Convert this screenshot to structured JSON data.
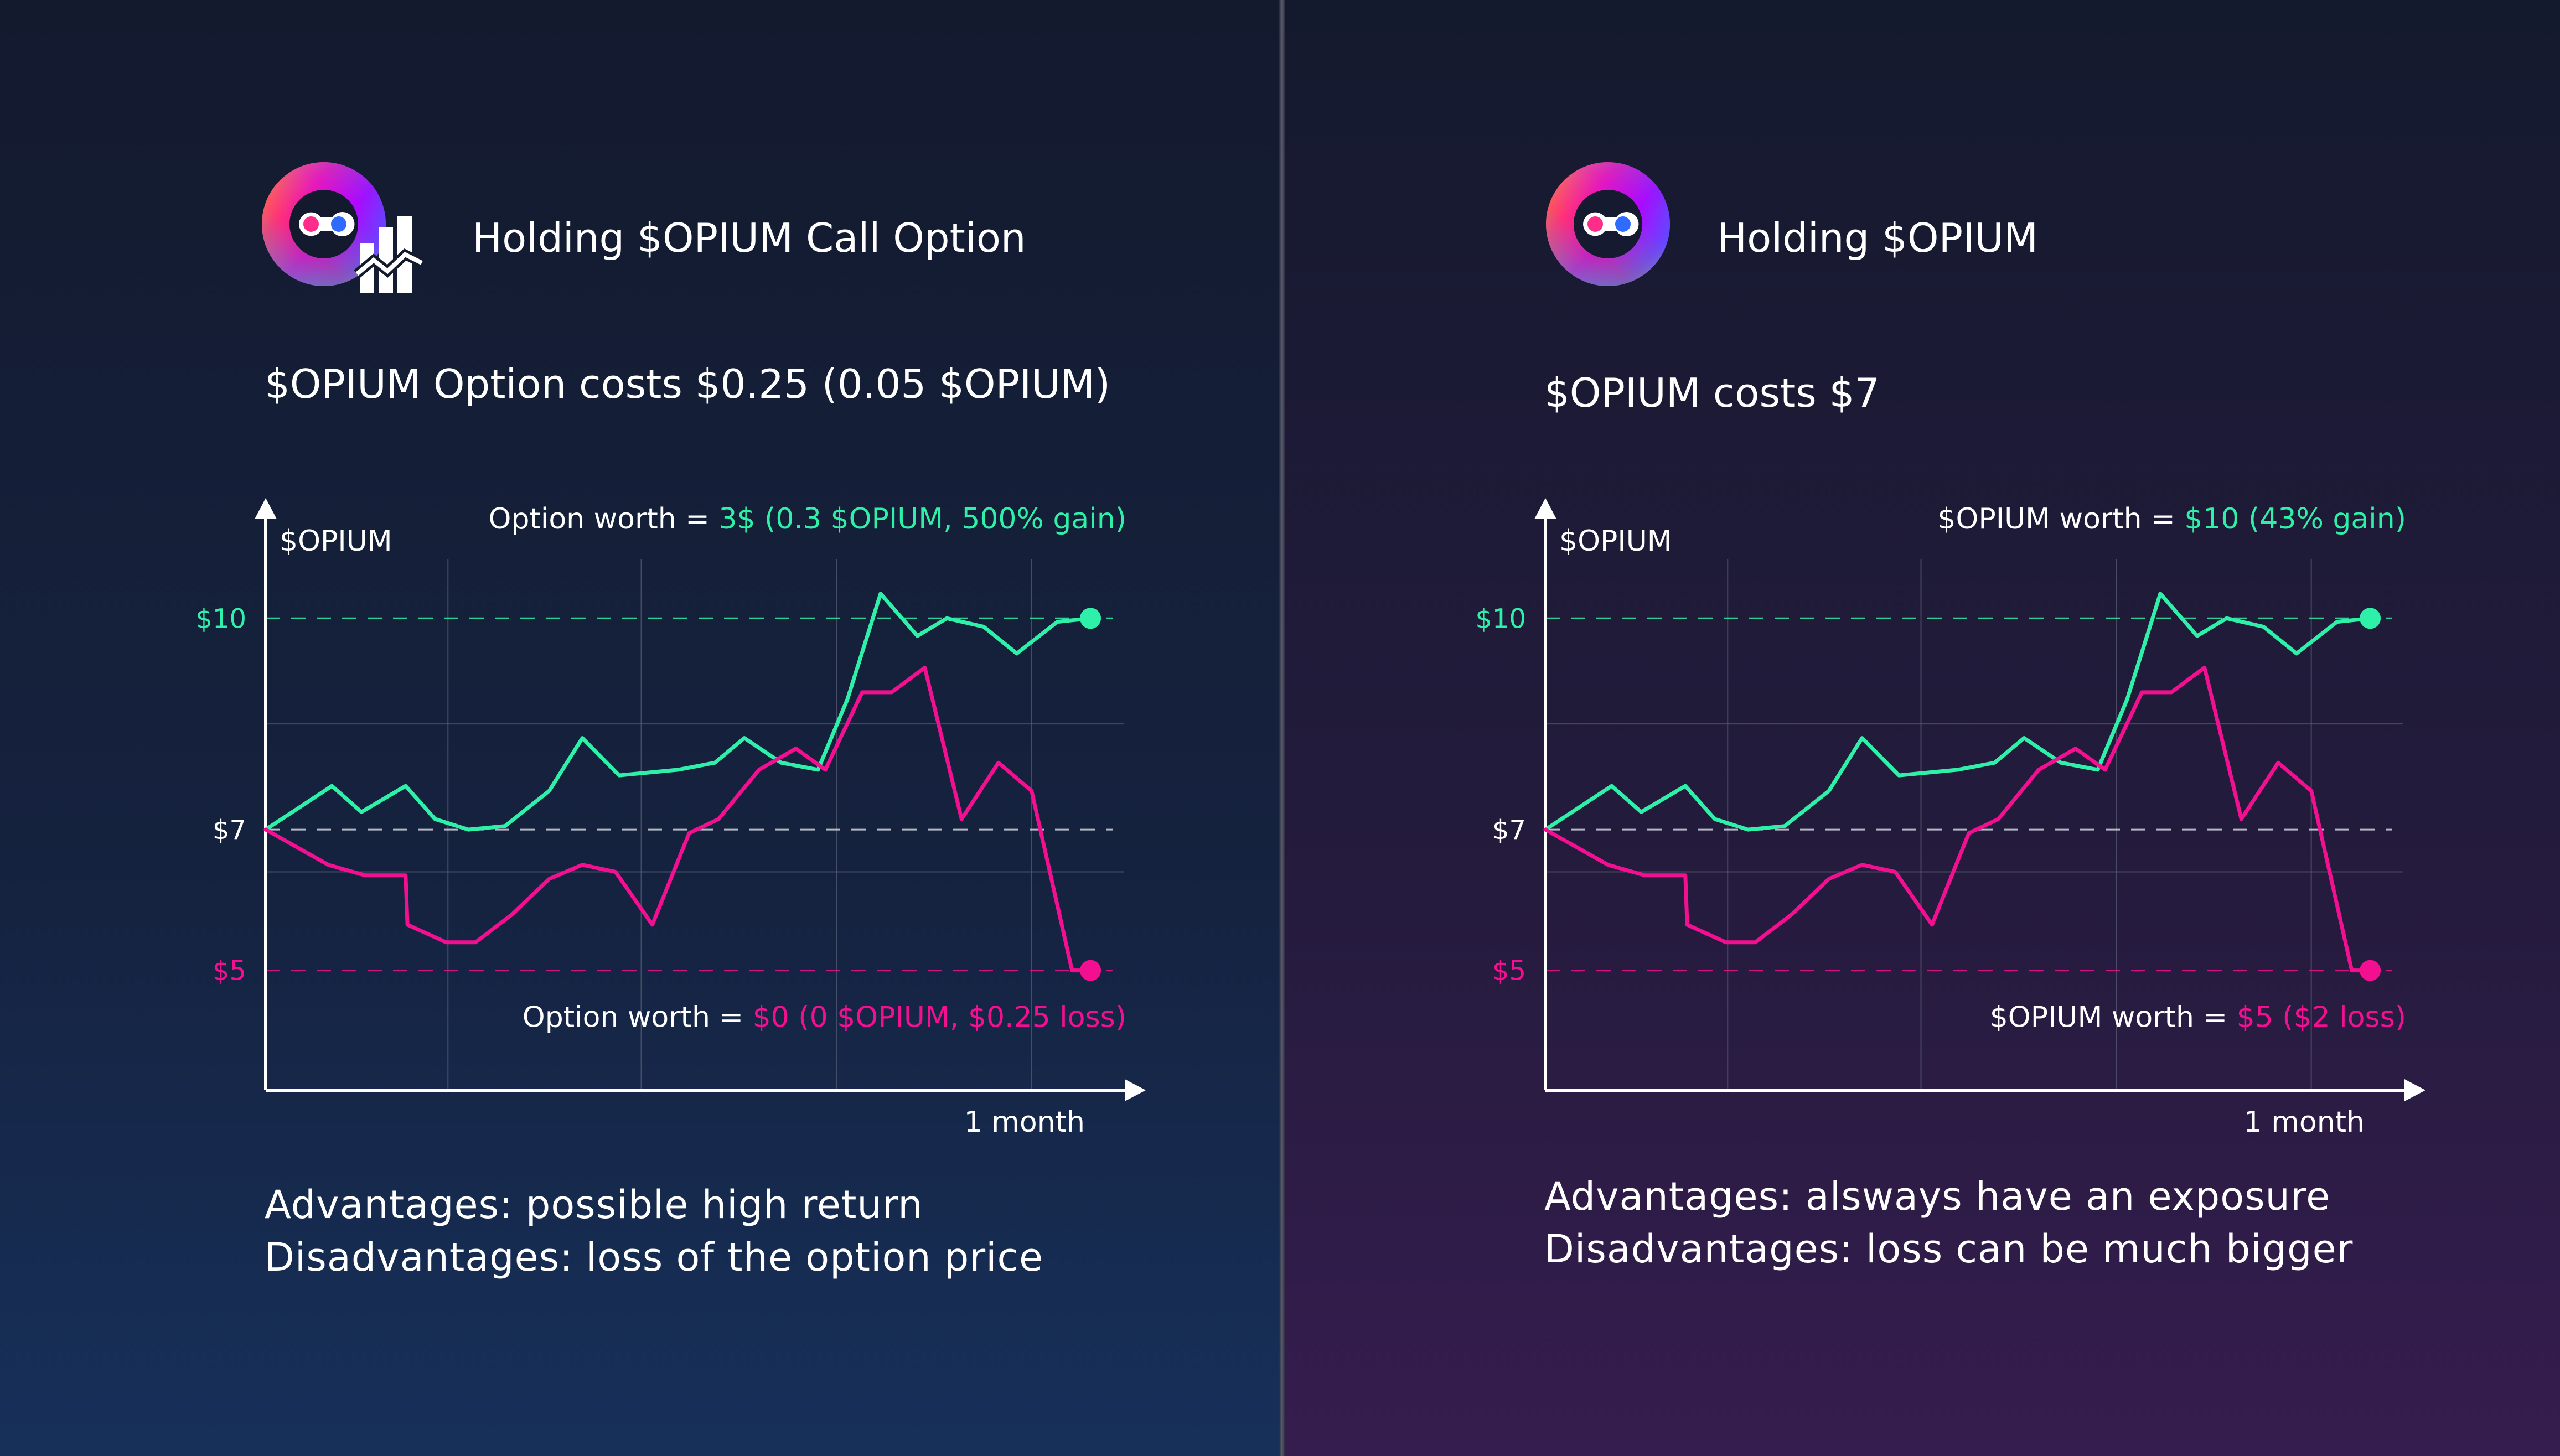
{
  "colors": {
    "green": "#2ff0a8",
    "pink": "#f20f90",
    "axis": "#ffffff",
    "grid": "#5a6075"
  },
  "panels": [
    {
      "title": "Holding $OPIUM Call Option",
      "subtitle": "$OPIUM Option costs $0.25 (0.05 $OPIUM)",
      "logo_icon": "opium-option-logo",
      "footer_line1": "Advantages: possible high return",
      "footer_line2": "Disadvantages: loss of the option price"
    },
    {
      "title": "Holding $OPIUM",
      "subtitle": "$OPIUM costs $7",
      "logo_icon": "opium-logo",
      "footer_line1": "Advantages: alsways have an exposure",
      "footer_line2": "Disadvantages: loss can be much bigger"
    }
  ],
  "chart_data": [
    {
      "type": "line",
      "ylabel": "$OPIUM",
      "xlabel": "1 month",
      "ylim": [
        3.3,
        11.0
      ],
      "xlim": [
        0,
        23
      ],
      "yticks": [
        {
          "value": 10,
          "label": "$10",
          "color": "#2ff0a8"
        },
        {
          "value": 7,
          "label": "$7",
          "color": "#ffffff"
        },
        {
          "value": 5,
          "label": "$5",
          "color": "#f20f90"
        }
      ],
      "annotation_top": {
        "prefix": "Option worth = ",
        "value": "3$ (0.3 $OPIUM, 500% gain)"
      },
      "annotation_bottom": {
        "prefix": "Option worth = ",
        "value": "$0 (0 $OPIUM, $0.25 loss)"
      },
      "series": [
        {
          "color": "#2ff0a8",
          "points": [
            [
              0,
              7.0
            ],
            [
              1.8,
              7.62
            ],
            [
              2.6,
              7.25
            ],
            [
              3.8,
              7.62
            ],
            [
              4.6,
              7.15
            ],
            [
              5.5,
              7.0
            ],
            [
              6.5,
              7.05
            ],
            [
              7.7,
              7.55
            ],
            [
              8.6,
              8.3
            ],
            [
              9.6,
              7.77
            ],
            [
              11.2,
              7.85
            ],
            [
              12.2,
              7.95
            ],
            [
              13.0,
              8.3
            ],
            [
              14.0,
              7.95
            ],
            [
              15.0,
              7.85
            ],
            [
              15.8,
              8.85
            ],
            [
              16.7,
              10.35
            ],
            [
              17.7,
              9.75
            ],
            [
              18.5,
              10.0
            ],
            [
              19.5,
              9.88
            ],
            [
              20.4,
              9.5
            ],
            [
              21.5,
              9.95
            ],
            [
              22.4,
              10.0
            ]
          ]
        },
        {
          "color": "#f20f90",
          "points": [
            [
              0,
              7.0
            ],
            [
              1.7,
              6.5
            ],
            [
              2.7,
              6.35
            ],
            [
              3.8,
              6.35
            ],
            [
              3.85,
              5.65
            ],
            [
              4.9,
              5.4
            ],
            [
              5.7,
              5.4
            ],
            [
              6.7,
              5.8
            ],
            [
              7.7,
              6.3
            ],
            [
              8.6,
              6.5
            ],
            [
              9.5,
              6.4
            ],
            [
              10.5,
              5.65
            ],
            [
              11.5,
              6.95
            ],
            [
              12.3,
              7.15
            ],
            [
              13.4,
              7.85
            ],
            [
              14.4,
              8.15
            ],
            [
              15.2,
              7.85
            ],
            [
              16.2,
              8.95
            ],
            [
              17.0,
              8.95
            ],
            [
              17.9,
              9.3
            ],
            [
              18.9,
              7.15
            ],
            [
              19.9,
              7.95
            ],
            [
              20.8,
              7.55
            ],
            [
              21.9,
              5.0
            ],
            [
              22.4,
              5.0
            ]
          ]
        }
      ]
    },
    {
      "type": "line",
      "ylabel": "$OPIUM",
      "xlabel": "1 month",
      "ylim": [
        3.3,
        11.0
      ],
      "xlim": [
        0,
        23
      ],
      "yticks": [
        {
          "value": 10,
          "label": "$10",
          "color": "#2ff0a8"
        },
        {
          "value": 7,
          "label": "$7",
          "color": "#ffffff"
        },
        {
          "value": 5,
          "label": "$5",
          "color": "#f20f90"
        }
      ],
      "annotation_top": {
        "prefix": "$OPIUM worth = ",
        "value": "$10 (43% gain)"
      },
      "annotation_bottom": {
        "prefix": "$OPIUM worth = ",
        "value": "$5 ($2 loss)"
      },
      "series": [
        {
          "color": "#2ff0a8",
          "points": [
            [
              0,
              7.0
            ],
            [
              1.8,
              7.62
            ],
            [
              2.6,
              7.25
            ],
            [
              3.8,
              7.62
            ],
            [
              4.6,
              7.15
            ],
            [
              5.5,
              7.0
            ],
            [
              6.5,
              7.05
            ],
            [
              7.7,
              7.55
            ],
            [
              8.6,
              8.3
            ],
            [
              9.6,
              7.77
            ],
            [
              11.2,
              7.85
            ],
            [
              12.2,
              7.95
            ],
            [
              13.0,
              8.3
            ],
            [
              14.0,
              7.95
            ],
            [
              15.0,
              7.85
            ],
            [
              15.8,
              8.85
            ],
            [
              16.7,
              10.35
            ],
            [
              17.7,
              9.75
            ],
            [
              18.5,
              10.0
            ],
            [
              19.5,
              9.88
            ],
            [
              20.4,
              9.5
            ],
            [
              21.5,
              9.95
            ],
            [
              22.4,
              10.0
            ]
          ]
        },
        {
          "color": "#f20f90",
          "points": [
            [
              0,
              7.0
            ],
            [
              1.7,
              6.5
            ],
            [
              2.7,
              6.35
            ],
            [
              3.8,
              6.35
            ],
            [
              3.85,
              5.65
            ],
            [
              4.9,
              5.4
            ],
            [
              5.7,
              5.4
            ],
            [
              6.7,
              5.8
            ],
            [
              7.7,
              6.3
            ],
            [
              8.6,
              6.5
            ],
            [
              9.5,
              6.4
            ],
            [
              10.5,
              5.65
            ],
            [
              11.5,
              6.95
            ],
            [
              12.3,
              7.15
            ],
            [
              13.4,
              7.85
            ],
            [
              14.4,
              8.15
            ],
            [
              15.2,
              7.85
            ],
            [
              16.2,
              8.95
            ],
            [
              17.0,
              8.95
            ],
            [
              17.9,
              9.3
            ],
            [
              18.9,
              7.15
            ],
            [
              19.9,
              7.95
            ],
            [
              20.8,
              7.55
            ],
            [
              21.9,
              5.0
            ],
            [
              22.4,
              5.0
            ]
          ]
        }
      ]
    }
  ]
}
